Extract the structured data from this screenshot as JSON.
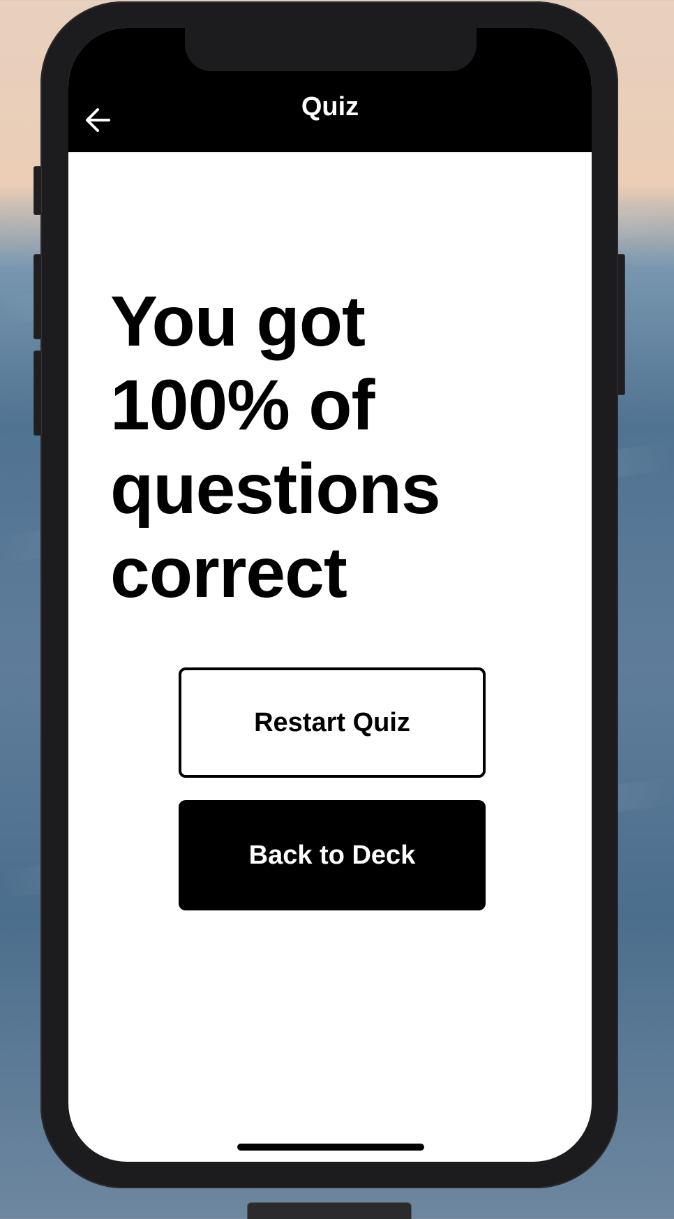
{
  "header": {
    "title": "Quiz",
    "back_icon": "arrow-left-icon"
  },
  "main": {
    "result_text": "You got 100% of questions correct",
    "score_percent": 100
  },
  "actions": {
    "restart_label": "Restart Quiz",
    "back_to_deck_label": "Back to Deck"
  },
  "colors": {
    "navbar": "#000000",
    "primary_button": "#000000",
    "background": "#ffffff"
  }
}
